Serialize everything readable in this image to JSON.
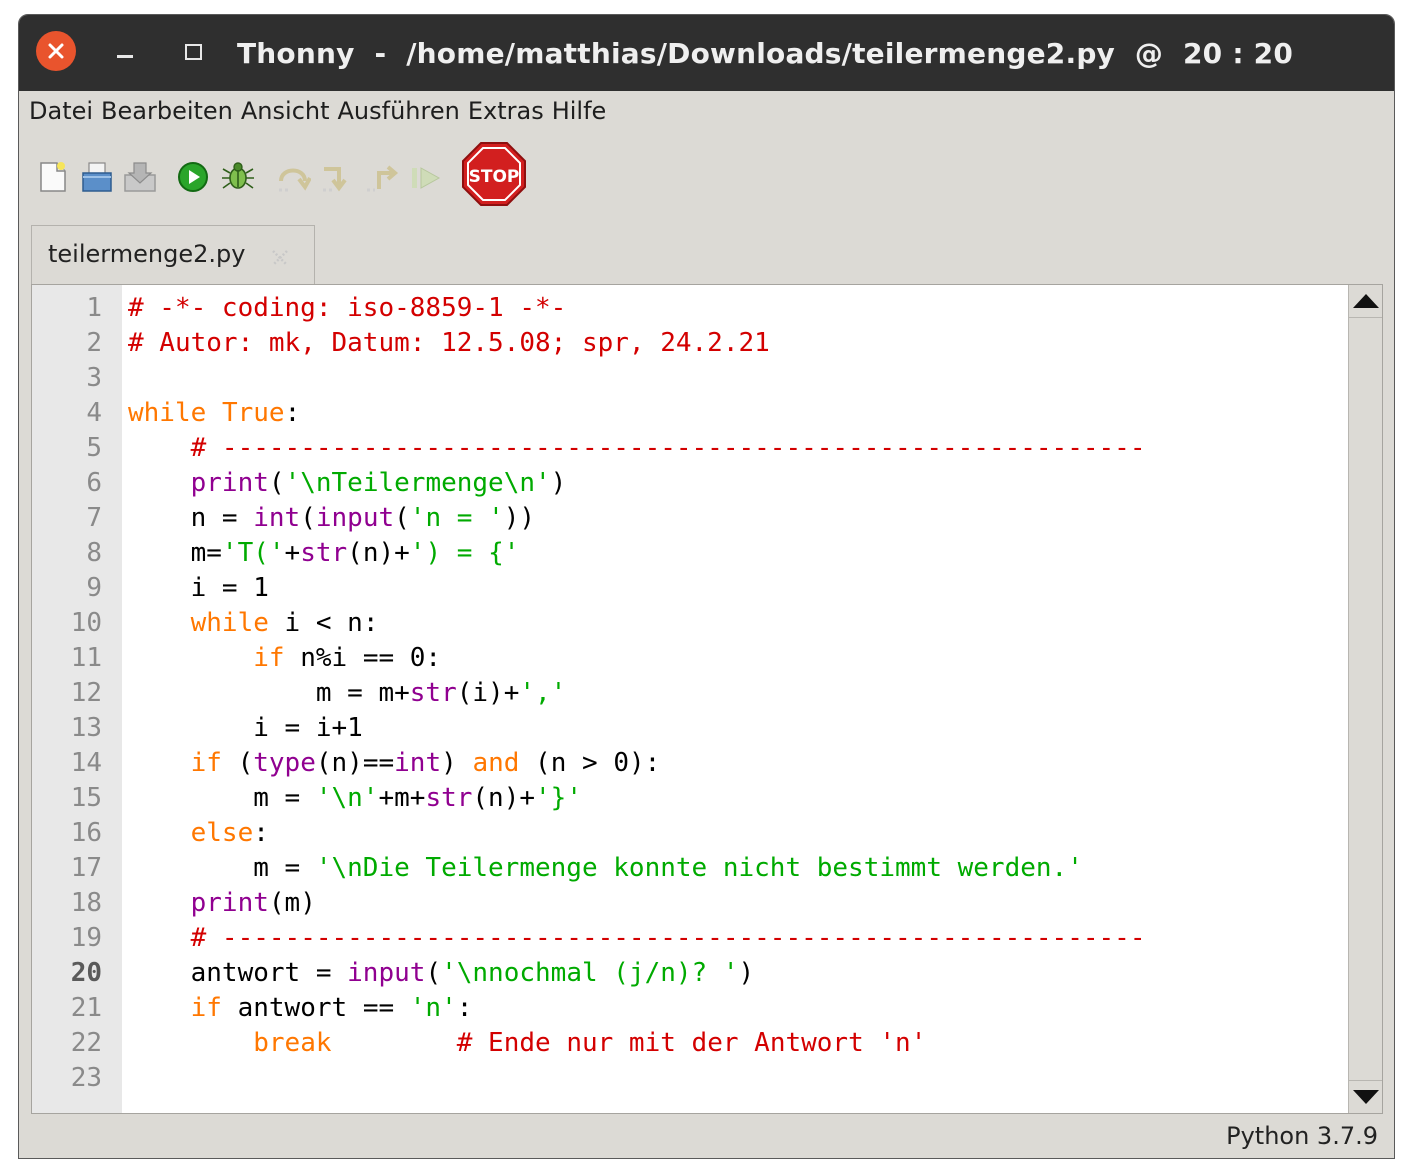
{
  "window": {
    "app": "Thonny",
    "path": "/home/matthias/Downloads/teilermenge2.py",
    "cursor": "20 : 20",
    "title_text": "Thonny  -  /home/matthias/Downloads/teilermenge2.py  @  20 : 20"
  },
  "menu": [
    {
      "label": "Datei"
    },
    {
      "label": "Bearbeiten"
    },
    {
      "label": "Ansicht"
    },
    {
      "label": "Ausführen"
    },
    {
      "label": "Extras"
    },
    {
      "label": "Hilfe"
    }
  ],
  "toolbar": {
    "stop_label": "STOP"
  },
  "tab": {
    "label": "teilermenge2.py"
  },
  "editor": {
    "current_line": 20,
    "lines": [
      {
        "n": "1",
        "tokens": [
          [
            "comment",
            "# -*- coding: iso-8859-1 -*-"
          ]
        ]
      },
      {
        "n": "2",
        "tokens": [
          [
            "comment",
            "# Autor: mk, Datum: 12.5.08; spr, 24.2.21"
          ]
        ]
      },
      {
        "n": "3",
        "tokens": []
      },
      {
        "n": "4",
        "tokens": [
          [
            "keyword",
            "while"
          ],
          [
            "default",
            " "
          ],
          [
            "keyword",
            "True"
          ],
          [
            "default",
            ":"
          ]
        ]
      },
      {
        "n": "5",
        "tokens": [
          [
            "default",
            "    "
          ],
          [
            "comment",
            "# -----------------------------------------------------------"
          ]
        ]
      },
      {
        "n": "6",
        "tokens": [
          [
            "default",
            "    "
          ],
          [
            "builtin",
            "print"
          ],
          [
            "default",
            "("
          ],
          [
            "string",
            "'\\nTeilermenge\\n'"
          ],
          [
            "default",
            ")"
          ]
        ]
      },
      {
        "n": "7",
        "tokens": [
          [
            "default",
            "    n = "
          ],
          [
            "builtin",
            "int"
          ],
          [
            "default",
            "("
          ],
          [
            "builtin",
            "input"
          ],
          [
            "default",
            "("
          ],
          [
            "string",
            "'n = '"
          ],
          [
            "default",
            "))"
          ]
        ]
      },
      {
        "n": "8",
        "tokens": [
          [
            "default",
            "    m="
          ],
          [
            "string",
            "'T('"
          ],
          [
            "default",
            "+"
          ],
          [
            "builtin",
            "str"
          ],
          [
            "default",
            "(n)+"
          ],
          [
            "string",
            "') = {'"
          ]
        ]
      },
      {
        "n": "9",
        "tokens": [
          [
            "default",
            "    i = 1"
          ]
        ]
      },
      {
        "n": "10",
        "tokens": [
          [
            "default",
            "    "
          ],
          [
            "keyword",
            "while"
          ],
          [
            "default",
            " i < n:"
          ]
        ]
      },
      {
        "n": "11",
        "tokens": [
          [
            "default",
            "        "
          ],
          [
            "keyword",
            "if"
          ],
          [
            "default",
            " n%i == 0:"
          ]
        ]
      },
      {
        "n": "12",
        "tokens": [
          [
            "default",
            "            m = m+"
          ],
          [
            "builtin",
            "str"
          ],
          [
            "default",
            "(i)+"
          ],
          [
            "string",
            "','"
          ]
        ]
      },
      {
        "n": "13",
        "tokens": [
          [
            "default",
            "        i = i+1"
          ]
        ]
      },
      {
        "n": "14",
        "tokens": [
          [
            "default",
            "    "
          ],
          [
            "keyword",
            "if"
          ],
          [
            "default",
            " ("
          ],
          [
            "builtin",
            "type"
          ],
          [
            "default",
            "(n)=="
          ],
          [
            "builtin",
            "int"
          ],
          [
            "default",
            ") "
          ],
          [
            "keyword",
            "and"
          ],
          [
            "default",
            " (n > 0):"
          ]
        ]
      },
      {
        "n": "15",
        "tokens": [
          [
            "default",
            "        m = "
          ],
          [
            "string",
            "'\\n'"
          ],
          [
            "default",
            "+m+"
          ],
          [
            "builtin",
            "str"
          ],
          [
            "default",
            "(n)+"
          ],
          [
            "string",
            "'}'"
          ]
        ]
      },
      {
        "n": "16",
        "tokens": [
          [
            "default",
            "    "
          ],
          [
            "keyword",
            "else"
          ],
          [
            "default",
            ":"
          ]
        ]
      },
      {
        "n": "17",
        "tokens": [
          [
            "default",
            "        m = "
          ],
          [
            "string",
            "'\\nDie Teilermenge konnte nicht bestimmt werden.'"
          ]
        ]
      },
      {
        "n": "18",
        "tokens": [
          [
            "default",
            "    "
          ],
          [
            "builtin",
            "print"
          ],
          [
            "default",
            "(m)"
          ]
        ]
      },
      {
        "n": "19",
        "tokens": [
          [
            "default",
            "    "
          ],
          [
            "comment",
            "# -----------------------------------------------------------"
          ]
        ]
      },
      {
        "n": "20",
        "tokens": [
          [
            "default",
            "    antwort = "
          ],
          [
            "builtin",
            "input"
          ],
          [
            "default",
            "("
          ],
          [
            "string",
            "'\\nnochmal (j/n)? '"
          ],
          [
            "default",
            ")"
          ]
        ]
      },
      {
        "n": "21",
        "tokens": [
          [
            "default",
            "    "
          ],
          [
            "keyword",
            "if"
          ],
          [
            "default",
            " antwort == "
          ],
          [
            "string",
            "'n'"
          ],
          [
            "default",
            ":"
          ]
        ]
      },
      {
        "n": "22",
        "tokens": [
          [
            "default",
            "        "
          ],
          [
            "keyword",
            "break"
          ],
          [
            "default",
            "        "
          ],
          [
            "comment",
            "# Ende nur mit der Antwort 'n'"
          ]
        ]
      },
      {
        "n": "23",
        "tokens": []
      }
    ]
  },
  "status": {
    "interpreter": "Python 3.7.9"
  },
  "colors": {
    "comment": "#d30000",
    "keyword": "#ff7700",
    "builtin": "#900090",
    "string": "#00aa00",
    "titlebar": "#2f2f2f",
    "close": "#e9542d"
  }
}
